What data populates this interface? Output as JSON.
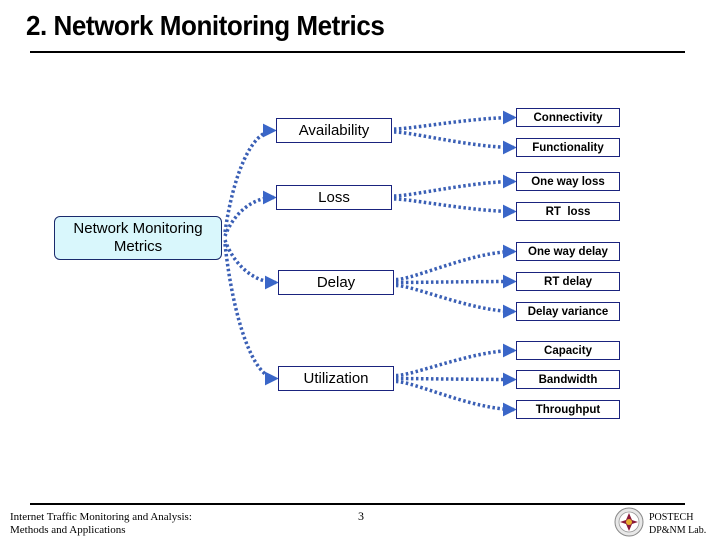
{
  "slide": {
    "title": "2. Network Monitoring Metrics",
    "page_number": "3",
    "footer_left_line1": "Internet Traffic Monitoring and Analysis:",
    "footer_left_line2": "Methods and Applications",
    "footer_right_line1": "POSTECH",
    "footer_right_line2": "DP&NM Lab.",
    "logo_icon": "postech-logo-icon"
  },
  "colors": {
    "connector": "#3a5fb5",
    "node_border": "#1a237e",
    "root_fill": "#d9f7fc"
  },
  "diagram": {
    "root": {
      "label_line1": "Network Monitoring",
      "label_line2": "Metrics"
    },
    "categories": [
      {
        "label": "Availability",
        "children": [
          "Connectivity",
          "Functionality"
        ]
      },
      {
        "label": "Loss",
        "children": [
          "One way loss",
          "RT  loss"
        ]
      },
      {
        "label": "Delay",
        "children": [
          "One way delay",
          "RT delay",
          "Delay variance"
        ]
      },
      {
        "label": "Utilization",
        "children": [
          "Capacity",
          "Bandwidth",
          "Throughput"
        ]
      }
    ]
  }
}
